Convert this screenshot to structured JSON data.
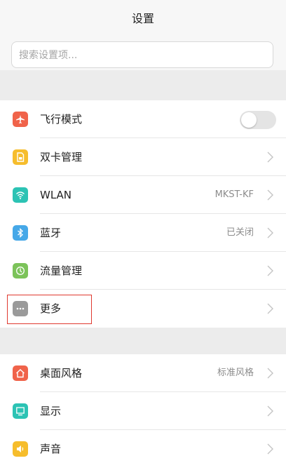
{
  "header": {
    "title": "设置"
  },
  "search": {
    "placeholder": "搜索设置项..."
  },
  "section1": {
    "items": [
      {
        "label": "飞行模式",
        "control": "toggle",
        "toggle_on": false,
        "icon": "airplane-icon",
        "icon_color": "#f0634a"
      },
      {
        "label": "双卡管理",
        "value": "",
        "icon": "sim-card-icon",
        "icon_color": "#f6bd2c"
      },
      {
        "label": "WLAN",
        "value": "MKST-KF",
        "icon": "wifi-icon",
        "icon_color": "#2cc3b4"
      },
      {
        "label": "蓝牙",
        "value": "已关闭",
        "icon": "bluetooth-icon",
        "icon_color": "#46a8e8"
      },
      {
        "label": "流量管理",
        "value": "",
        "icon": "data-usage-icon",
        "icon_color": "#7cc35a"
      },
      {
        "label": "更多",
        "value": "",
        "icon": "more-icon",
        "icon_color": "#9a9a9a"
      }
    ]
  },
  "section2": {
    "items": [
      {
        "label": "桌面风格",
        "value": "标准风格",
        "icon": "home-icon",
        "icon_color": "#f0634a"
      },
      {
        "label": "显示",
        "value": "",
        "icon": "display-icon",
        "icon_color": "#2cc3b4"
      },
      {
        "label": "声音",
        "value": "",
        "icon": "sound-icon",
        "icon_color": "#f6bd2c"
      }
    ]
  },
  "colors": {
    "highlight_box": "#e0392f",
    "chevron": "#c4c4c4"
  }
}
